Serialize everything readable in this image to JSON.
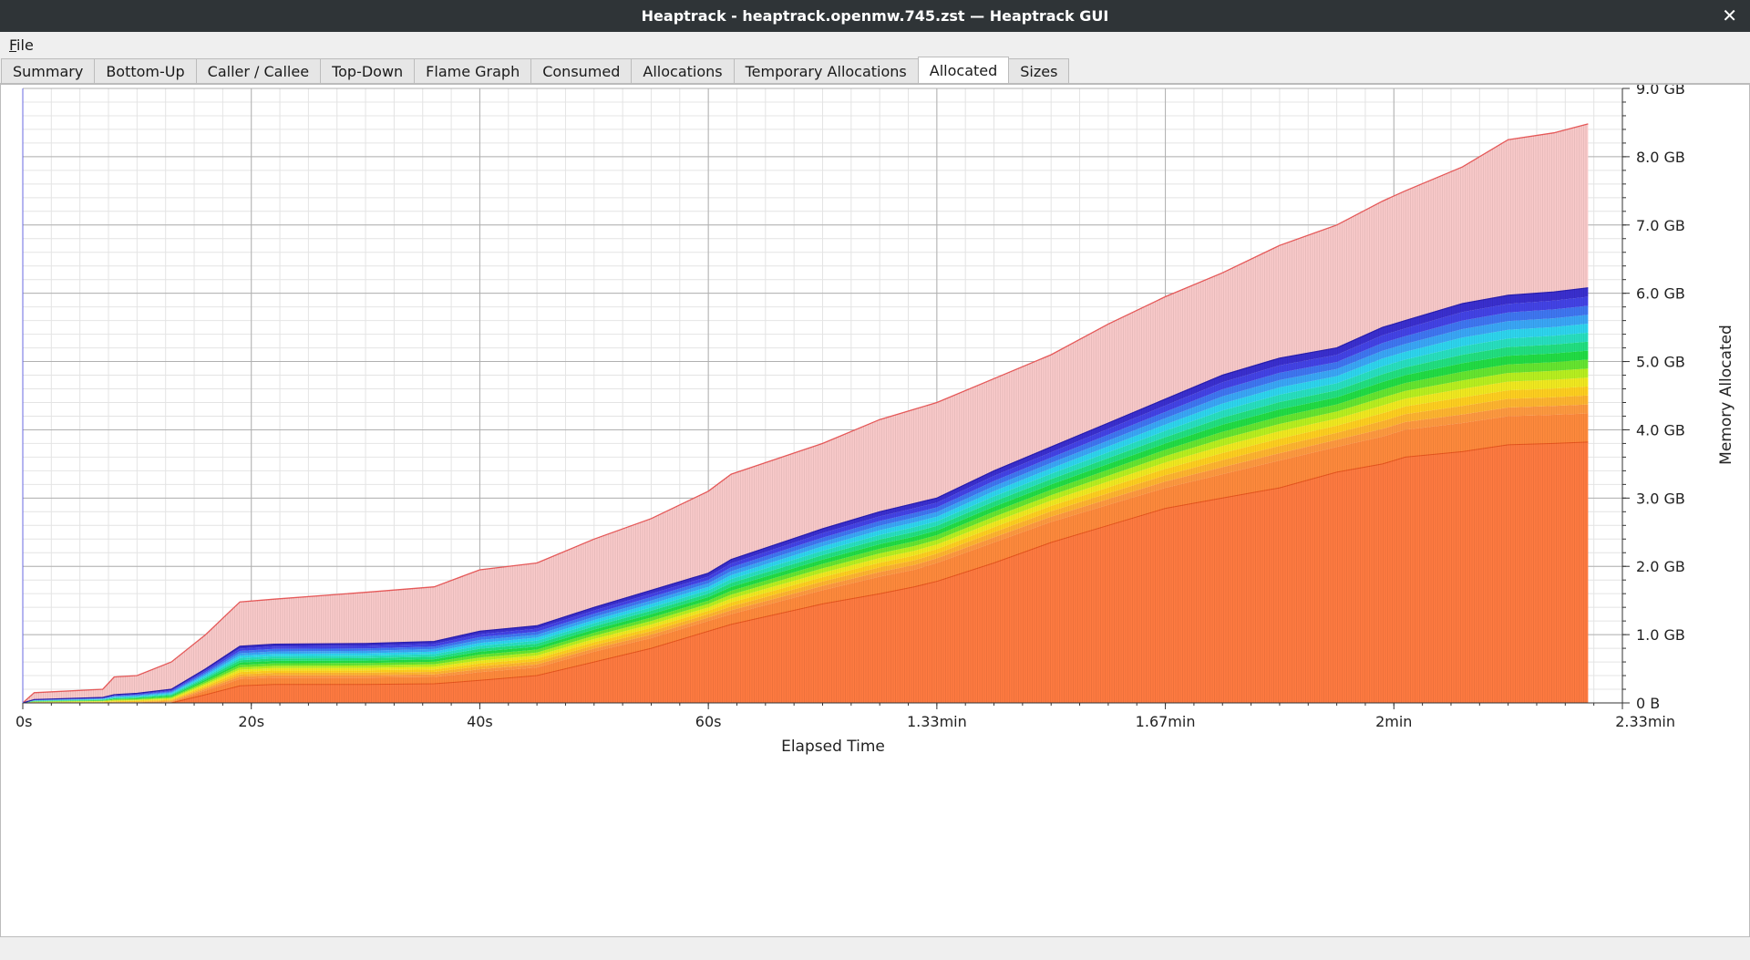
{
  "window": {
    "title": "Heaptrack - heaptrack.openmw.745.zst — Heaptrack GUI",
    "close_glyph": "✕"
  },
  "menu": {
    "items": [
      {
        "label": "File",
        "mnemonic": "F",
        "rest": "ile"
      }
    ]
  },
  "tabs": [
    {
      "label": "Summary",
      "active": false
    },
    {
      "label": "Bottom-Up",
      "active": false
    },
    {
      "label": "Caller / Callee",
      "active": false
    },
    {
      "label": "Top-Down",
      "active": false
    },
    {
      "label": "Flame Graph",
      "active": false
    },
    {
      "label": "Consumed",
      "active": false
    },
    {
      "label": "Allocations",
      "active": false
    },
    {
      "label": "Temporary Allocations",
      "active": false
    },
    {
      "label": "Allocated",
      "active": true
    },
    {
      "label": "Sizes",
      "active": false
    }
  ],
  "chart_data": {
    "type": "area",
    "stacked": true,
    "xlabel": "Elapsed Time",
    "ylabel": "Memory Allocated",
    "x_unit": "seconds",
    "y_unit": "GB",
    "xlim": [
      0,
      140
    ],
    "ylim": [
      0,
      9
    ],
    "x_ticks": [
      {
        "value": 0,
        "label": "0s"
      },
      {
        "value": 20,
        "label": "20s"
      },
      {
        "value": 40,
        "label": "40s"
      },
      {
        "value": 60,
        "label": "60s"
      },
      {
        "value": 80,
        "label": "1.33min"
      },
      {
        "value": 100,
        "label": "1.67min"
      },
      {
        "value": 120,
        "label": "2min"
      },
      {
        "value": 140,
        "label": "2.33min"
      }
    ],
    "y_ticks": [
      {
        "value": 0,
        "label": "0 B"
      },
      {
        "value": 1,
        "label": "1.0 GB"
      },
      {
        "value": 2,
        "label": "2.0 GB"
      },
      {
        "value": 3,
        "label": "3.0 GB"
      },
      {
        "value": 4,
        "label": "4.0 GB"
      },
      {
        "value": 5,
        "label": "5.0 GB"
      },
      {
        "value": 6,
        "label": "6.0 GB"
      },
      {
        "value": 7,
        "label": "7.0 GB"
      },
      {
        "value": 8,
        "label": "8.0 GB"
      },
      {
        "value": 9,
        "label": "9.0 GB"
      }
    ],
    "grid": true,
    "x": [
      0,
      1,
      7,
      8,
      10,
      13,
      16,
      19,
      22,
      30,
      36,
      40,
      45,
      50,
      55,
      60,
      62,
      70,
      75,
      78,
      80,
      85,
      90,
      95,
      100,
      105,
      110,
      115,
      119,
      121,
      126,
      130,
      134,
      137
    ],
    "total": [
      0,
      0.15,
      0.2,
      0.38,
      0.4,
      0.6,
      1.0,
      1.48,
      1.52,
      1.62,
      1.7,
      1.95,
      2.05,
      2.4,
      2.7,
      3.1,
      3.35,
      3.8,
      4.15,
      4.3,
      4.4,
      4.75,
      5.1,
      5.55,
      5.95,
      6.3,
      6.7,
      7.0,
      7.35,
      7.5,
      7.85,
      8.25,
      8.35,
      8.48
    ],
    "stack_top": [
      0,
      0.05,
      0.08,
      0.12,
      0.14,
      0.2,
      0.5,
      0.83,
      0.86,
      0.87,
      0.9,
      1.05,
      1.13,
      1.4,
      1.65,
      1.9,
      2.1,
      2.55,
      2.8,
      2.92,
      3.0,
      3.4,
      3.75,
      4.1,
      4.45,
      4.8,
      5.05,
      5.2,
      5.5,
      5.6,
      5.85,
      5.97,
      6.02,
      6.08
    ],
    "base_bottom": [
      0,
      0,
      0,
      0,
      0,
      0,
      0.12,
      0.25,
      0.27,
      0.27,
      0.28,
      0.33,
      0.4,
      0.6,
      0.8,
      1.05,
      1.15,
      1.45,
      1.6,
      1.7,
      1.78,
      2.05,
      2.35,
      2.6,
      2.85,
      3.0,
      3.15,
      3.38,
      3.5,
      3.6,
      3.68,
      3.78,
      3.8,
      3.82
    ],
    "base_top": [
      0,
      0,
      0,
      0,
      0,
      0.01,
      0.18,
      0.35,
      0.37,
      0.37,
      0.38,
      0.45,
      0.52,
      0.75,
      0.95,
      1.2,
      1.3,
      1.65,
      1.85,
      1.95,
      2.05,
      2.35,
      2.65,
      2.9,
      3.15,
      3.35,
      3.55,
      3.75,
      3.9,
      4.0,
      4.1,
      4.2,
      4.22,
      4.24
    ],
    "colors": {
      "total_fill": "#f9caca",
      "total_line": "#e85a5a",
      "base_fill": "#ff7a40",
      "base_line": "#e8561e",
      "band_palette": [
        "#ff9a40",
        "#ffb530",
        "#ffd020",
        "#f2ea20",
        "#b8f020",
        "#66e630",
        "#22dd44",
        "#22e080",
        "#28e0c0",
        "#2ed6ef",
        "#3aa7f7",
        "#3f77f2",
        "#4343e6",
        "#3a2fcf"
      ]
    }
  }
}
